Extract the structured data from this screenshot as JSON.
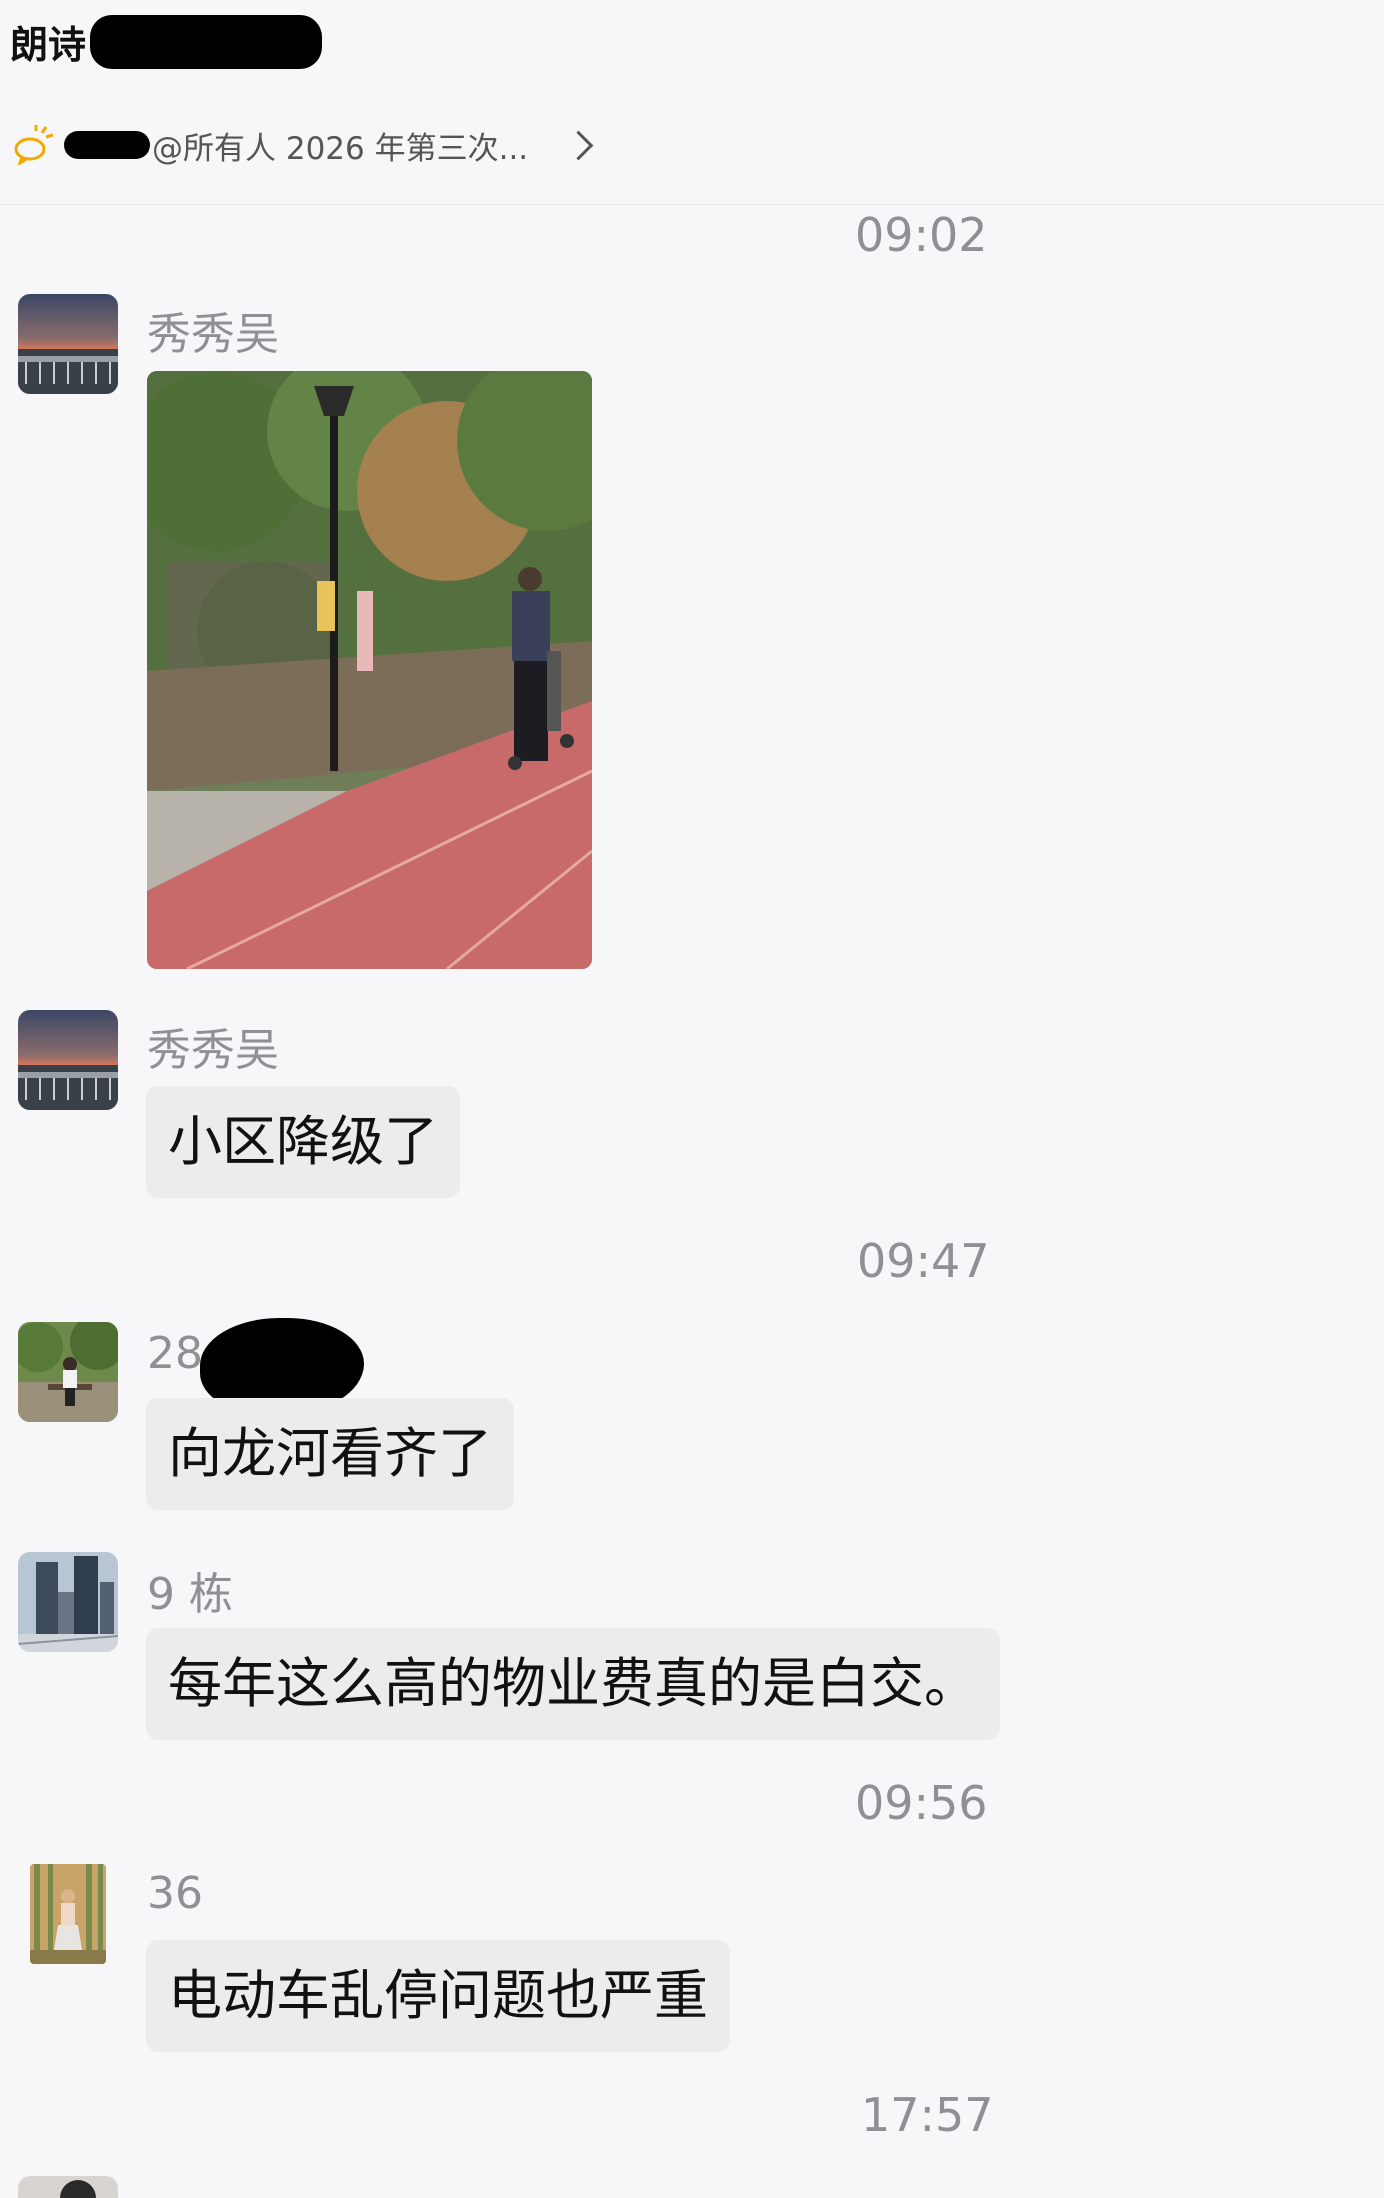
{
  "header": {
    "group_title": "朗诗",
    "notice_text": "@所有人 2026 年第三次..."
  },
  "messages": [
    {
      "time": "09:02"
    },
    {
      "sender": "秀秀吴",
      "type": "image"
    },
    {
      "sender": "秀秀吴",
      "text": "小区降级了"
    },
    {
      "time": "09:47"
    },
    {
      "sender": "28",
      "text": "向龙河看齐了"
    },
    {
      "sender": "9 栋",
      "text": "每年这么高的物业费真的是白交。"
    },
    {
      "time": "09:56"
    },
    {
      "sender": "36",
      "text": "电动车乱停问题也严重"
    },
    {
      "time": "17:57"
    }
  ],
  "colors": {
    "background": "#f7f7f9",
    "bubble": "#ececee",
    "meta_text": "#8f8f94",
    "track_red": "#c86a6a"
  },
  "icons": [
    "announcement-icon",
    "chevron-right-icon"
  ]
}
